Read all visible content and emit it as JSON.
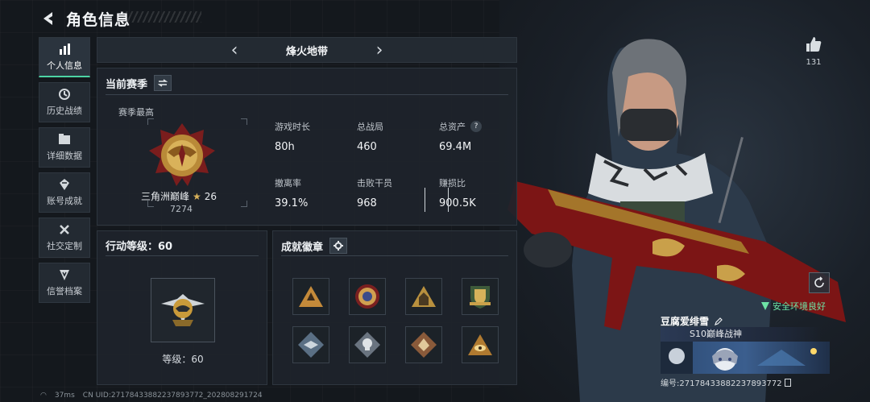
{
  "header": {
    "title": "角色信息"
  },
  "sidebar": {
    "items": [
      {
        "label": "个人信息",
        "icon": "bar-chart-icon",
        "active": true
      },
      {
        "label": "历史战绩",
        "icon": "history-icon"
      },
      {
        "label": "详细数据",
        "icon": "folder-icon"
      },
      {
        "label": "账号成就",
        "icon": "achievement-icon"
      },
      {
        "label": "社交定制",
        "icon": "tools-icon"
      },
      {
        "label": "信誉档案",
        "icon": "shield-icon"
      }
    ]
  },
  "season_bar": {
    "name": "烽火地带"
  },
  "current_season": {
    "title": "当前赛季",
    "season_high_label": "赛季最高",
    "rank_name": "三角洲巅峰",
    "rank_stars": "26",
    "rank_score": "7274",
    "stats": [
      {
        "label": "游戏时长",
        "value": "80h"
      },
      {
        "label": "总战局",
        "value": "460"
      },
      {
        "label": "总资产",
        "value": "69.4M",
        "help": "?"
      },
      {
        "label": "撤离率",
        "value": "39.1%"
      },
      {
        "label": "击败干员",
        "value": "968"
      },
      {
        "label": "赚损比",
        "value": "900.5K"
      }
    ]
  },
  "action_level": {
    "title": "行动等级：60",
    "level_text": "等级：60"
  },
  "achievements": {
    "title": "成就徽章",
    "badges": [
      "triangle-hand-badge",
      "round-emblem-badge",
      "triangle-figure-badge",
      "shield-emblem-badge",
      "diamond-wing-badge",
      "diamond-skull-badge",
      "diamond-beast-badge",
      "triangle-eye-badge"
    ]
  },
  "footer": {
    "ping": "37ms",
    "uid": "CN UID:27178433882237893772_202808291724"
  },
  "profile": {
    "like_count": "131",
    "safety_status": "安全环境良好",
    "player_name": "豆腐爱绯雪",
    "title_tag": "S10巅峰战神",
    "serial": "编号:27178433882237893772"
  },
  "colors": {
    "accent": "#4cd3a4",
    "gold": "#d9b25a",
    "panel": "#1e242b"
  }
}
